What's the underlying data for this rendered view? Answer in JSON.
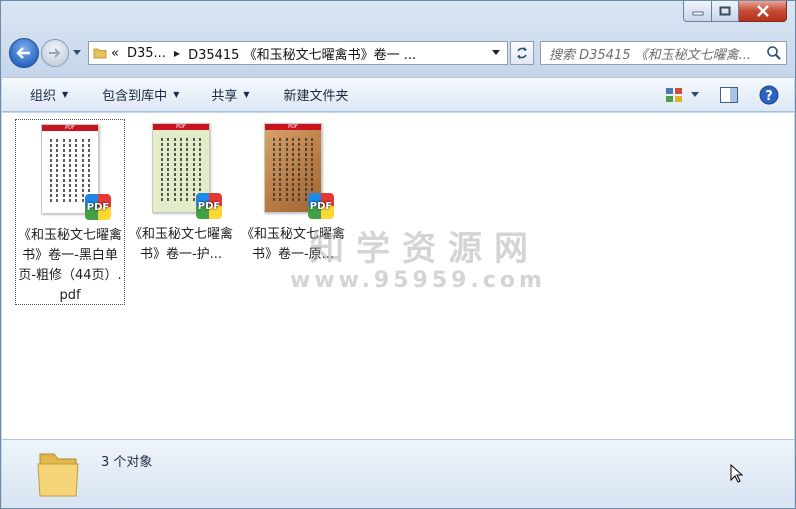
{
  "address": {
    "prefix": "«",
    "crumbs": [
      "D35...",
      "D35415 《和玉秘文七曜禽书》卷一 ..."
    ]
  },
  "search": {
    "placeholder": "搜索 D35415 《和玉秘文七曜禽..."
  },
  "toolbar": {
    "organize": "组织",
    "include_library": "包含到库中",
    "share": "共享",
    "new_folder": "新建文件夹"
  },
  "files": [
    {
      "label": "《和玉秘文七曜禽书》卷一-黑白单页-粗修（44页）.pdf",
      "badge": "PDF",
      "header": "PDF"
    },
    {
      "label": "《和玉秘文七曜禽书》卷一-护...",
      "badge": "PDF",
      "header": "PDF"
    },
    {
      "label": "《和玉秘文七曜禽书》卷一-原...",
      "badge": "PDF",
      "header": "PDF"
    }
  ],
  "watermark": {
    "text": "知学资源网",
    "url": "www.95959.com"
  },
  "status": {
    "count_text": "3 个对象"
  },
  "colors": {
    "accent": "#2c68c5",
    "close": "#c74a33",
    "pdf_red": "#c8141e"
  }
}
